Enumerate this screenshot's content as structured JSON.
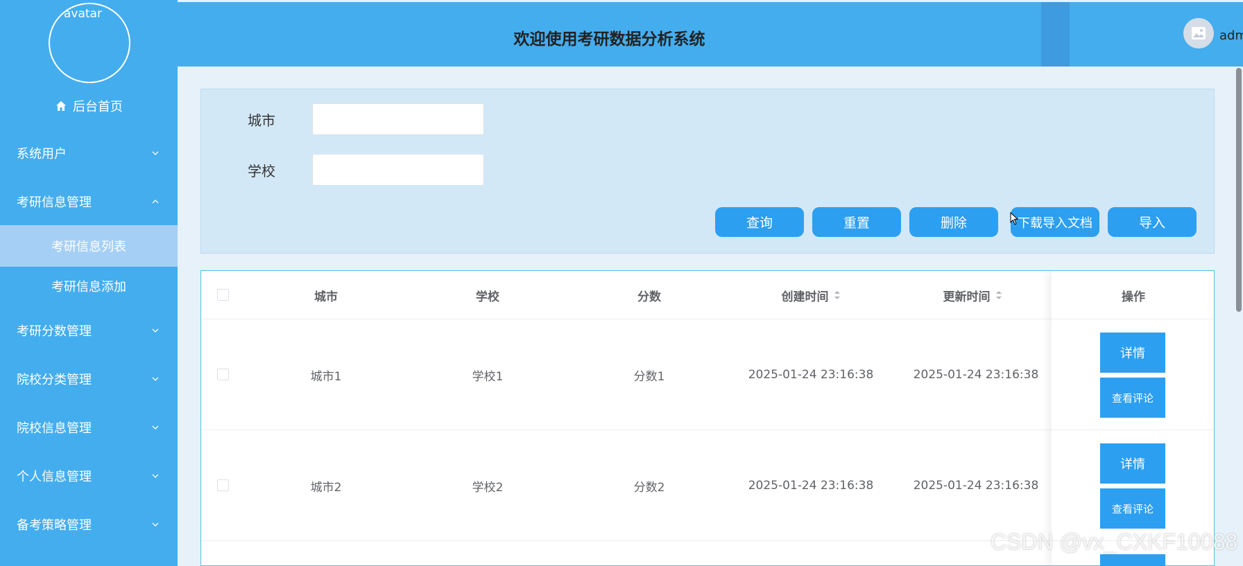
{
  "sidebar": {
    "avatar_label": "avatar",
    "home": "后台首页",
    "menu": [
      {
        "label": "系统用户",
        "expanded": false
      },
      {
        "label": "考研信息管理",
        "expanded": true
      },
      {
        "label": "考研分数管理",
        "expanded": false
      },
      {
        "label": "院校分类管理",
        "expanded": false
      },
      {
        "label": "院校信息管理",
        "expanded": false
      },
      {
        "label": "个人信息管理",
        "expanded": false
      },
      {
        "label": "备考策略管理",
        "expanded": false
      }
    ],
    "submenu": [
      {
        "label": "考研信息列表",
        "active": true
      },
      {
        "label": "考研信息添加",
        "active": false
      }
    ]
  },
  "header": {
    "title": "欢迎使用考研数据分析系统",
    "user": "admi"
  },
  "search": {
    "city_label": "城市",
    "city_value": "",
    "school_label": "学校",
    "school_value": "",
    "buttons": {
      "query": "查询",
      "reset": "重置",
      "delete": "删除",
      "download": "下载导入文档",
      "import": "导入"
    }
  },
  "table": {
    "headers": {
      "city": "城市",
      "school": "学校",
      "score": "分数",
      "created": "创建时间",
      "updated": "更新时间",
      "ops": "操作"
    },
    "rows": [
      {
        "city": "城市1",
        "school": "学校1",
        "score": "分数1",
        "created": "2025-01-24 23:16:38",
        "updated": "2025-01-24 23:16:38"
      },
      {
        "city": "城市2",
        "school": "学校2",
        "score": "分数2",
        "created": "2025-01-24 23:16:38",
        "updated": "2025-01-24 23:16:38"
      }
    ],
    "op_detail": "详情",
    "op_review": "查看评论"
  },
  "watermark": "CSDN @vx_CXKF10088",
  "colors": {
    "primary": "#44adee",
    "button": "#2d9ff0",
    "active_submenu": "#a6cff5"
  }
}
